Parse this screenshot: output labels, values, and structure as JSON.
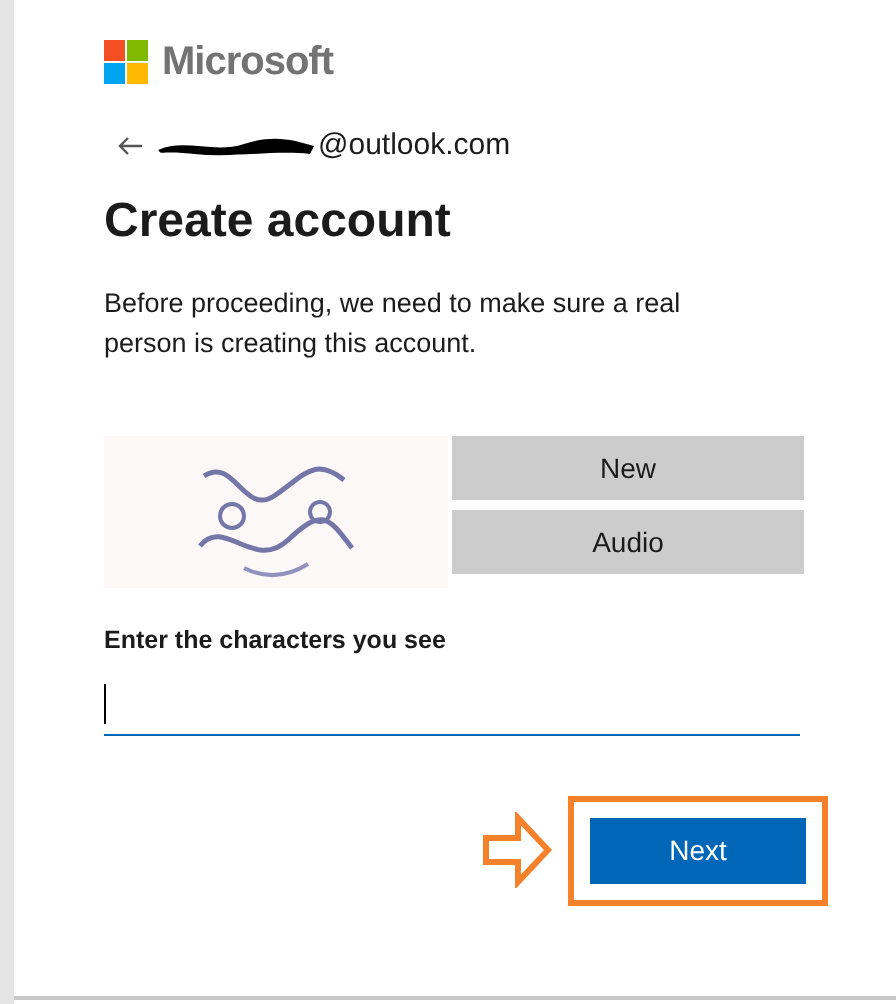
{
  "brand": {
    "name": "Microsoft"
  },
  "account": {
    "email": "@outlook.com",
    "redacted": true
  },
  "title": "Create account",
  "description": "Before proceeding, we need to make sure a real person is creating this account.",
  "captcha": {
    "buttons": [
      "New",
      "Audio"
    ]
  },
  "field": {
    "label": "Enter the characters you see",
    "focused": true
  },
  "next_button": {
    "label": "Next",
    "highlighted": true
  }
}
